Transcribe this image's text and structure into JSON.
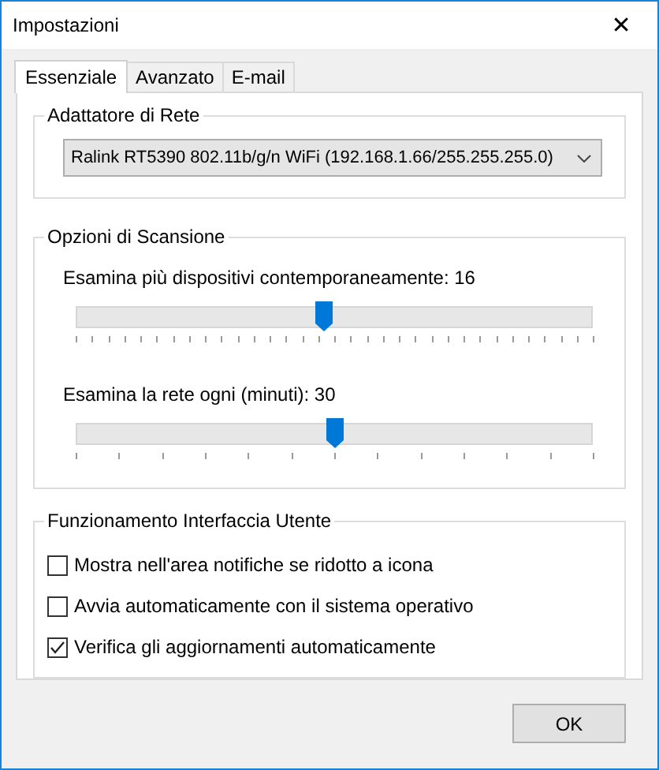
{
  "window": {
    "title": "Impostazioni",
    "close": "✕"
  },
  "tabs": [
    {
      "label": "Essenziale",
      "selected": true
    },
    {
      "label": "Avanzato",
      "selected": false
    },
    {
      "label": "E-mail",
      "selected": false
    }
  ],
  "adapter_group": {
    "title": "Adattatore di Rete",
    "dropdown": {
      "value": "Ralink RT5390 802.11b/g/n WiFi (192.168.1.66/255.255.255.0)"
    }
  },
  "scan_group": {
    "title": "Opzioni di Scansione",
    "sliders": [
      {
        "label": "Esamina più dispositivi contemporaneamente: 16",
        "level": 0.48
      },
      {
        "label": "Esamina la rete ogni (minuti): 30",
        "level": 0.5
      }
    ]
  },
  "ui_group": {
    "title": "Funzionamento Interfaccia Utente",
    "checkboxes": [
      {
        "label": "Mostra nell'area notifiche se ridotto a icona",
        "checked": false
      },
      {
        "label": "Avvia automaticamente con il sistema operativo",
        "checked": false
      },
      {
        "label": "Verifica gli aggiornamenti automaticamente",
        "checked": true
      }
    ]
  },
  "buttons": [
    "OK"
  ]
}
